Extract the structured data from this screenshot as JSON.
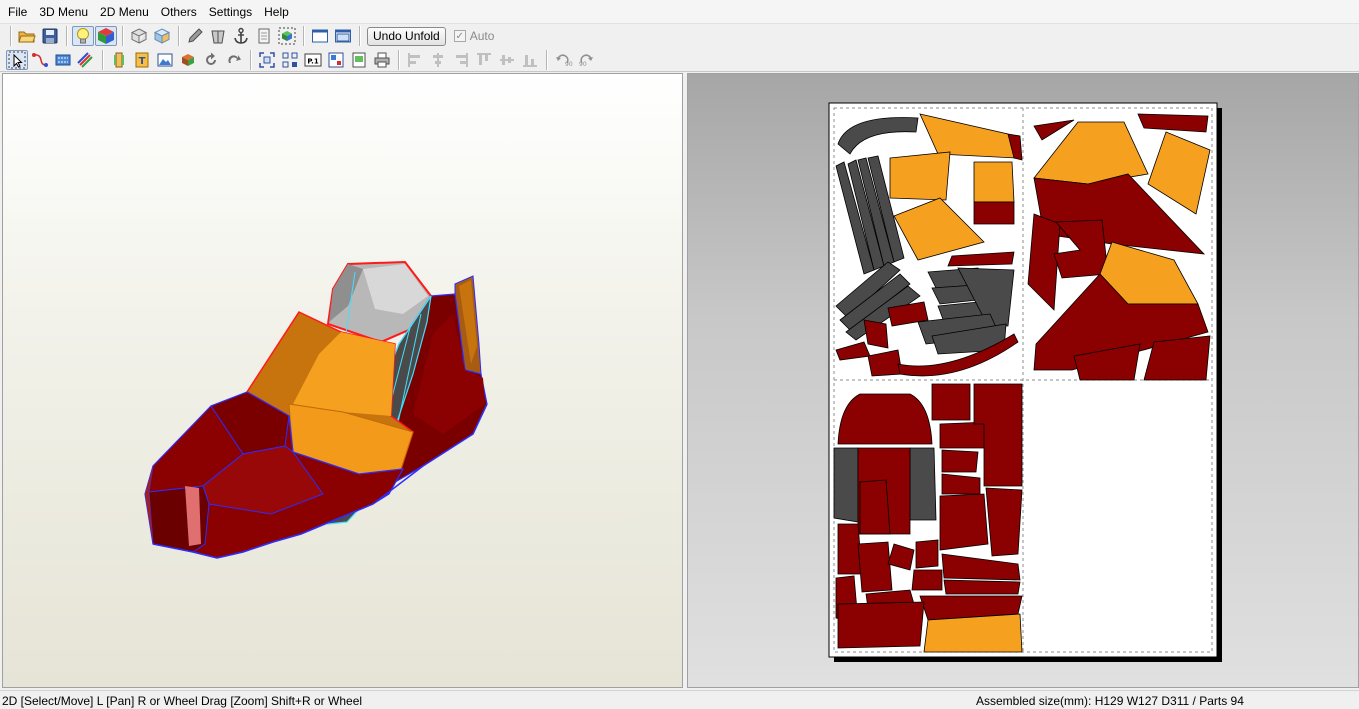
{
  "menu": {
    "file": "File",
    "menu3d": "3D Menu",
    "menu2d": "2D Menu",
    "others": "Others",
    "settings": "Settings",
    "help": "Help"
  },
  "toolbar1": {
    "undo_unfold_label": "Undo Unfold",
    "auto_label": "Auto",
    "auto_checked": true
  },
  "toolbar2": {
    "page1_glyph": "P.1"
  },
  "status": {
    "left": "2D [Select/Move] L [Pan] R or Wheel Drag [Zoom] Shift+R or Wheel",
    "right": "Assembled size(mm): H129 W127 D311 / Parts 94"
  },
  "colors": {
    "dark_red": "#8b0000",
    "orange": "#f6a020",
    "dark_gray": "#4a4a4a",
    "brown": "#c7730e",
    "edge_red": "#ff1a1a",
    "edge_blue": "#2d2dff",
    "edge_cyan": "#40e0ff"
  }
}
